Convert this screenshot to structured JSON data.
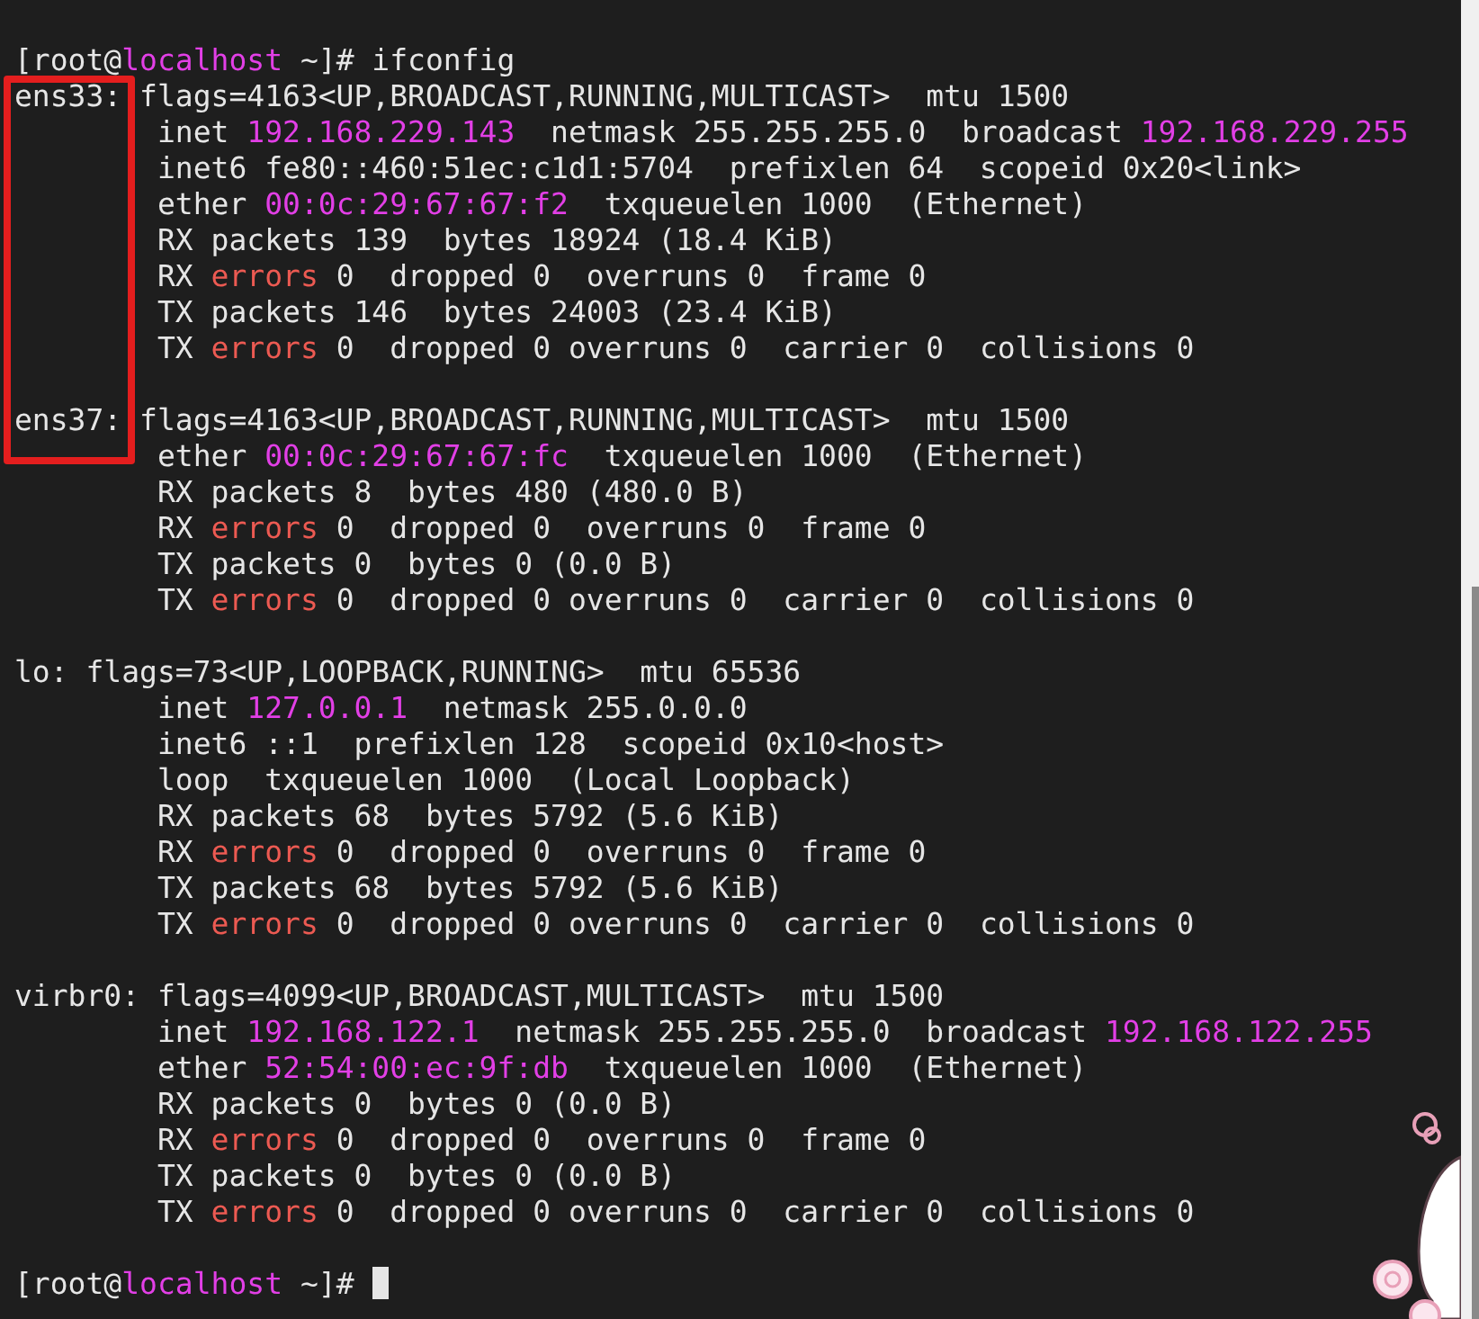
{
  "prompt": [
    {
      "text": "[root@",
      "kind": "plain"
    },
    {
      "text": "localhost",
      "kind": "address"
    },
    {
      "text": " ~]# ifconfig",
      "kind": "plain"
    }
  ],
  "interfaces": [
    {
      "highlighted": true,
      "lines": [
        [
          {
            "text": "ens33: flags=4163<UP,BROADCAST,RUNNING,MULTICAST>  mtu 1500",
            "kind": "plain"
          }
        ],
        [
          {
            "text": "        inet ",
            "kind": "plain"
          },
          {
            "text": "192.168.229.143",
            "kind": "address"
          },
          {
            "text": "  netmask 255.255.255.0  broadcast ",
            "kind": "plain"
          },
          {
            "text": "192.168.229.255",
            "kind": "address"
          }
        ],
        [
          {
            "text": "        inet6 fe80::460:51ec:c1d1:5704  prefixlen 64  scopeid 0x20<link>",
            "kind": "plain"
          }
        ],
        [
          {
            "text": "        ether ",
            "kind": "plain"
          },
          {
            "text": "00:0c:29:67:67:f2",
            "kind": "address"
          },
          {
            "text": "  txqueuelen 1000  (Ethernet)",
            "kind": "plain"
          }
        ],
        [
          {
            "text": "        RX packets 139  bytes 18924 (18.4 KiB)",
            "kind": "plain"
          }
        ],
        [
          {
            "text": "        RX ",
            "kind": "plain"
          },
          {
            "text": "errors",
            "kind": "error"
          },
          {
            "text": " 0  dropped 0  overruns 0  frame 0",
            "kind": "plain"
          }
        ],
        [
          {
            "text": "        TX packets 146  bytes 24003 (23.4 KiB)",
            "kind": "plain"
          }
        ],
        [
          {
            "text": "        TX ",
            "kind": "plain"
          },
          {
            "text": "errors",
            "kind": "error"
          },
          {
            "text": " 0  dropped 0 overruns 0  carrier 0  collisions 0",
            "kind": "plain"
          }
        ]
      ]
    },
    {
      "highlighted": true,
      "lines": [
        [
          {
            "text": "ens37: flags=4163<UP,BROADCAST,RUNNING,MULTICAST>  mtu 1500",
            "kind": "plain"
          }
        ],
        [
          {
            "text": "        ether ",
            "kind": "plain"
          },
          {
            "text": "00:0c:29:67:67:fc",
            "kind": "address"
          },
          {
            "text": "  txqueuelen 1000  (Ethernet)",
            "kind": "plain"
          }
        ],
        [
          {
            "text": "        RX packets 8  bytes 480 (480.0 B)",
            "kind": "plain"
          }
        ],
        [
          {
            "text": "        RX ",
            "kind": "plain"
          },
          {
            "text": "errors",
            "kind": "error"
          },
          {
            "text": " 0  dropped 0  overruns 0  frame 0",
            "kind": "plain"
          }
        ],
        [
          {
            "text": "        TX packets 0  bytes 0 (0.0 B)",
            "kind": "plain"
          }
        ],
        [
          {
            "text": "        TX ",
            "kind": "plain"
          },
          {
            "text": "errors",
            "kind": "error"
          },
          {
            "text": " 0  dropped 0 overruns 0  carrier 0  collisions 0",
            "kind": "plain"
          }
        ]
      ]
    },
    {
      "highlighted": false,
      "lines": [
        [
          {
            "text": "lo: flags=73<UP,LOOPBACK,RUNNING>  mtu 65536",
            "kind": "plain"
          }
        ],
        [
          {
            "text": "        inet ",
            "kind": "plain"
          },
          {
            "text": "127.0.0.1",
            "kind": "address"
          },
          {
            "text": "  netmask 255.0.0.0",
            "kind": "plain"
          }
        ],
        [
          {
            "text": "        inet6 ::1  prefixlen 128  scopeid 0x10<host>",
            "kind": "plain"
          }
        ],
        [
          {
            "text": "        loop  txqueuelen 1000  (Local Loopback)",
            "kind": "plain"
          }
        ],
        [
          {
            "text": "        RX packets 68  bytes 5792 (5.6 KiB)",
            "kind": "plain"
          }
        ],
        [
          {
            "text": "        RX ",
            "kind": "plain"
          },
          {
            "text": "errors",
            "kind": "error"
          },
          {
            "text": " 0  dropped 0  overruns 0  frame 0",
            "kind": "plain"
          }
        ],
        [
          {
            "text": "        TX packets 68  bytes 5792 (5.6 KiB)",
            "kind": "plain"
          }
        ],
        [
          {
            "text": "        TX ",
            "kind": "plain"
          },
          {
            "text": "errors",
            "kind": "error"
          },
          {
            "text": " 0  dropped 0 overruns 0  carrier 0  collisions 0",
            "kind": "plain"
          }
        ]
      ]
    },
    {
      "highlighted": false,
      "lines": [
        [
          {
            "text": "virbr0: flags=4099<UP,BROADCAST,MULTICAST>  mtu 1500",
            "kind": "plain"
          }
        ],
        [
          {
            "text": "        inet ",
            "kind": "plain"
          },
          {
            "text": "192.168.122.1",
            "kind": "address"
          },
          {
            "text": "  netmask 255.255.255.0  broadcast ",
            "kind": "plain"
          },
          {
            "text": "192.168.122.255",
            "kind": "address"
          }
        ],
        [
          {
            "text": "        ether ",
            "kind": "plain"
          },
          {
            "text": "52:54:00:ec:9f:db",
            "kind": "address"
          },
          {
            "text": "  txqueuelen 1000  (Ethernet)",
            "kind": "plain"
          }
        ],
        [
          {
            "text": "        RX packets 0  bytes 0 (0.0 B)",
            "kind": "plain"
          }
        ],
        [
          {
            "text": "        RX ",
            "kind": "plain"
          },
          {
            "text": "errors",
            "kind": "error"
          },
          {
            "text": " 0  dropped 0  overruns 0  frame 0",
            "kind": "plain"
          }
        ],
        [
          {
            "text": "        TX packets 0  bytes 0 (0.0 B)",
            "kind": "plain"
          }
        ],
        [
          {
            "text": "        TX ",
            "kind": "plain"
          },
          {
            "text": "errors",
            "kind": "error"
          },
          {
            "text": " 0  dropped 0 overruns 0  carrier 0  collisions 0",
            "kind": "plain"
          }
        ]
      ]
    }
  ],
  "final_prompt": [
    {
      "text": "[root@",
      "kind": "plain"
    },
    {
      "text": "localhost",
      "kind": "address"
    },
    {
      "text": " ~]# ",
      "kind": "plain"
    }
  ]
}
